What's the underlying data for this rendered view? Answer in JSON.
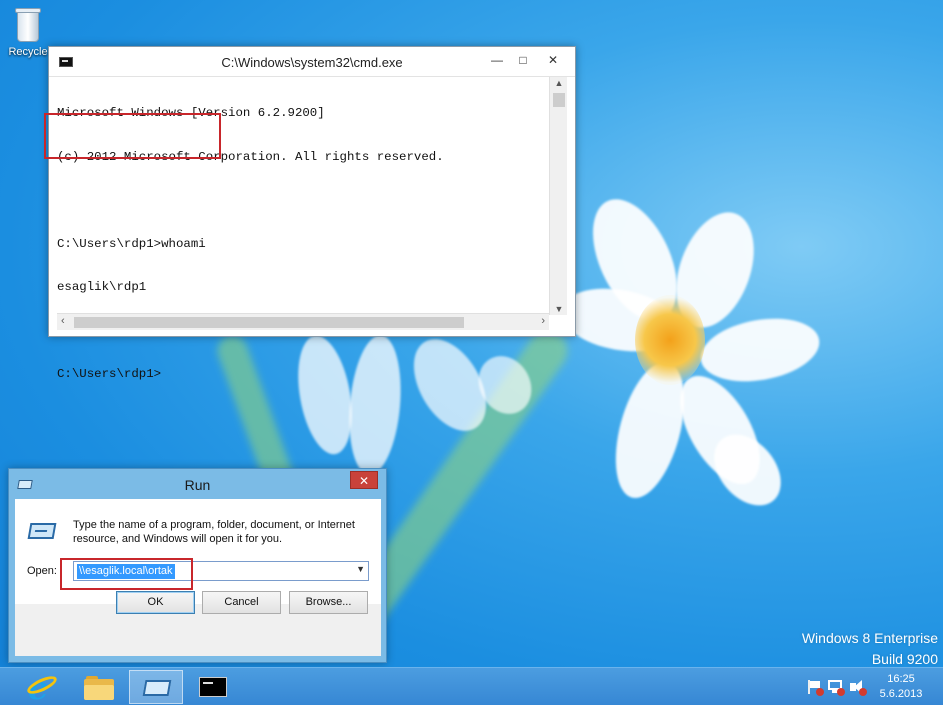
{
  "desktop": {
    "icons": [
      {
        "label": "Recycle"
      }
    ],
    "watermark": {
      "edition": "Windows 8 Enterprise",
      "build": "Build 9200"
    }
  },
  "cmd_window": {
    "title": "C:\\Windows\\system32\\cmd.exe",
    "lines": [
      "Microsoft Windows [Version 6.2.9200]",
      "(c) 2012 Microsoft Corporation. All rights reserved.",
      "",
      "C:\\Users\\rdp1>whoami",
      "esaglik\\rdp1",
      "",
      "C:\\Users\\rdp1>"
    ]
  },
  "run_dialog": {
    "title": "Run",
    "description": "Type the name of a program, folder, document, or Internet resource, and Windows will open it for you.",
    "open_label": "Open:",
    "open_value": "\\\\esaglik.local\\ortak",
    "buttons": {
      "ok": "OK",
      "cancel": "Cancel",
      "browse": "Browse..."
    }
  },
  "taskbar": {
    "clock_time": "16:25",
    "clock_date": "5.6.2013"
  },
  "colors": {
    "highlight_box": "#c8262b",
    "selection": "#3399ff",
    "taskbar": "#3a8bd6"
  }
}
